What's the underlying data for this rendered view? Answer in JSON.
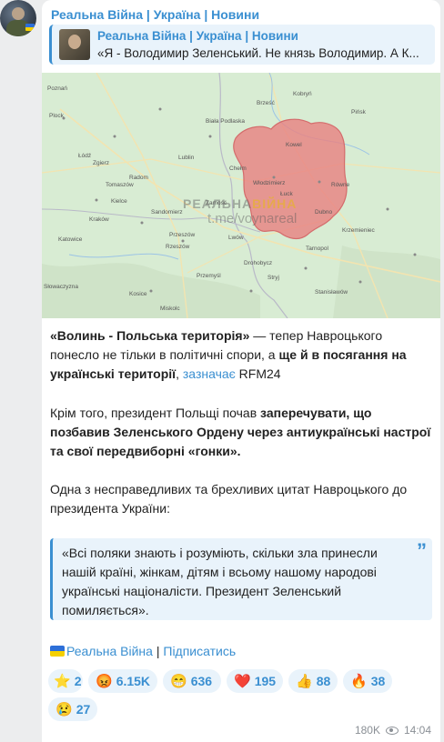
{
  "channel": {
    "name": "Реальна Війна | Україна | Новини"
  },
  "reply": {
    "title": "Реальна Війна | Україна | Новини",
    "text": "«Я - Володимир Зеленський. Не князь Володимир. А К..."
  },
  "map": {
    "watermark_main": "РЕАЛЬНА",
    "watermark_accent": "ВІЙНА",
    "watermark_handle": "t.me/voynareal",
    "labels": [
      "Plock",
      "Łódź",
      "Radom",
      "Lublin",
      "Kielce",
      "Kraków",
      "Katowice",
      "Rzeszów",
      "Przemyśl",
      "Lwów",
      "Tarnopol",
      "Łuck",
      "Równe",
      "Chełm",
      "Zamość",
      "Kowel",
      "Brześć",
      "Pińsk",
      "Słowaczyzna",
      "Kosice",
      "Przeszów",
      "Miskolc",
      "Drohobycz",
      "Stryj",
      "Stanisławów",
      "Poznań",
      "Zgierz",
      "Tomaszów",
      "Sandomierz",
      "Biała Podlaska",
      "Kobryń",
      "Włodzimierz",
      "Krzemieniec",
      "Dubno"
    ],
    "region_color": "#e88383"
  },
  "paragraphs": {
    "p1_b1": "«Волинь - Польська територія»",
    "p1_t1": " — тепер Навроцького понесло не тільки в політичні спори, а ",
    "p1_b2": "ще й в посягання на українські території",
    "p1_t2": ", ",
    "p1_link": "зазначає",
    "p1_t3": " RFM24",
    "p2_t1": "Крім того, президент Польщі почав ",
    "p2_b1": "заперечувати, що позбавив Зеленського Ордену через антиукраїнські настрої та свої передвиборні «гонки».",
    "p3": "Одна з несправедливих та брехливих цитат Навроцького до президента України:"
  },
  "quote": {
    "text": "«Всі поляки знають і розуміють, скільки зла принесли нашій країні, жінкам, дітям і всьому нашому народові українські націоналісти. Президент Зеленський помиляється».",
    "mark": "”"
  },
  "footer": {
    "channel_link": "Реальна Війна",
    "separator": " | ",
    "subscribe_link": "Підписатись"
  },
  "reactions": [
    {
      "emoji": "⭐",
      "count": "2",
      "icon": "star-icon"
    },
    {
      "emoji": "😡",
      "count": "6.15K",
      "icon": "angry-face-icon"
    },
    {
      "emoji": "😁",
      "count": "636",
      "icon": "grin-face-icon"
    },
    {
      "emoji": "❤️",
      "count": "195",
      "icon": "heart-icon"
    },
    {
      "emoji": "👍",
      "count": "88",
      "icon": "thumbs-up-icon"
    },
    {
      "emoji": "🔥",
      "count": "38",
      "icon": "fire-icon"
    },
    {
      "emoji": "😢",
      "count": "27",
      "icon": "crying-face-icon"
    }
  ],
  "meta": {
    "views": "180K",
    "time": "14:04"
  },
  "colors": {
    "accent": "#3a8fd1",
    "background": "#ecedee"
  }
}
